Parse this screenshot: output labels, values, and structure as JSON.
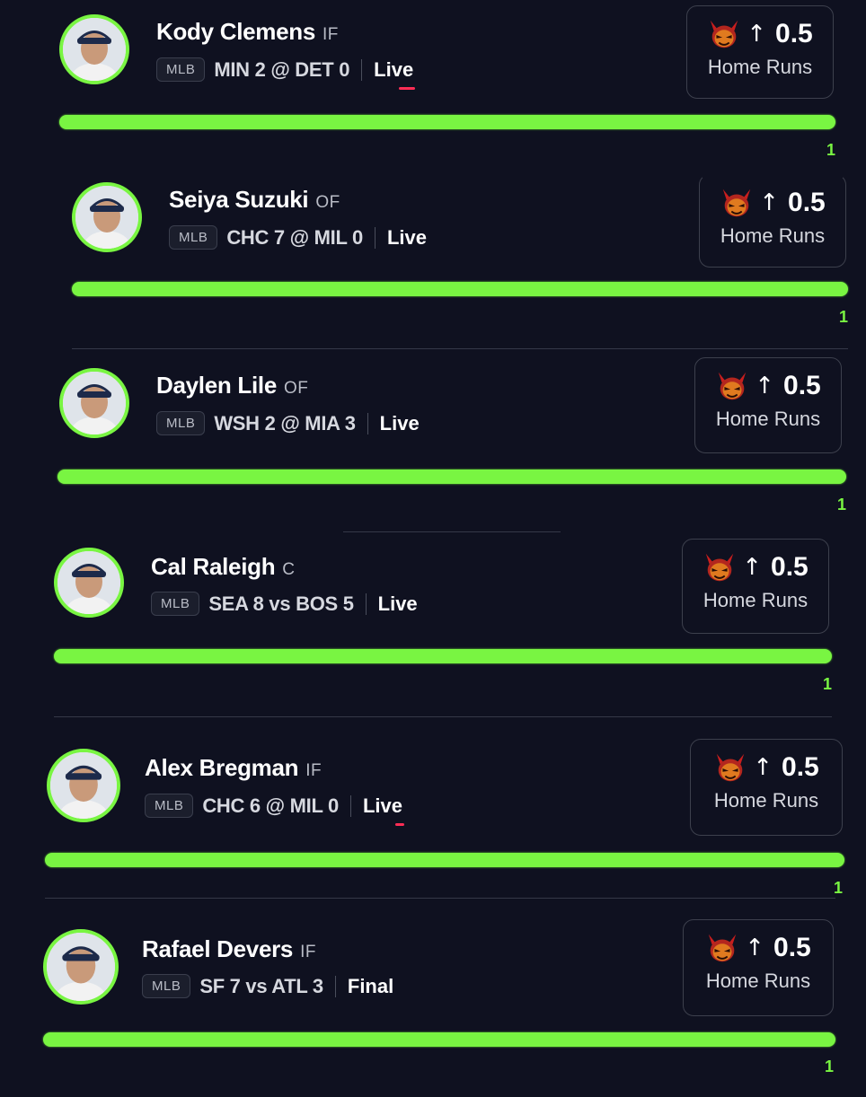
{
  "accent_color": "#79f542",
  "live_color": "#ff2d55",
  "picks": [
    {
      "player": "Kody Clemens",
      "position": "IF",
      "league": "MLB",
      "score": "MIN 2 @ DET 0",
      "status": "Live",
      "direction_icon": "arrow-up-icon",
      "line": "0.5",
      "stat": "Home Runs",
      "progress": "1",
      "progress_fraction": 1.0
    },
    {
      "player": "Seiya Suzuki",
      "position": "OF",
      "league": "MLB",
      "score": "CHC 7 @ MIL 0",
      "status": "Live",
      "direction_icon": "arrow-up-icon",
      "line": "0.5",
      "stat": "Home Runs",
      "progress": "1",
      "progress_fraction": 1.0
    },
    {
      "player": "Daylen Lile",
      "position": "OF",
      "league": "MLB",
      "score": "WSH 2 @ MIA 3",
      "status": "Live",
      "direction_icon": "arrow-up-icon",
      "line": "0.5",
      "stat": "Home Runs",
      "progress": "1",
      "progress_fraction": 1.0
    },
    {
      "player": "Cal Raleigh",
      "position": "C",
      "league": "MLB",
      "score": "SEA 8 vs BOS 5",
      "status": "Live",
      "direction_icon": "arrow-up-icon",
      "line": "0.5",
      "stat": "Home Runs",
      "progress": "1",
      "progress_fraction": 1.0
    },
    {
      "player": "Alex Bregman",
      "position": "IF",
      "league": "MLB",
      "score": "CHC 6 @ MIL 0",
      "status": "Live",
      "direction_icon": "arrow-up-icon",
      "line": "0.5",
      "stat": "Home Runs",
      "progress": "1",
      "progress_fraction": 1.0
    },
    {
      "player": "Rafael Devers",
      "position": "IF",
      "league": "MLB",
      "score": "SF 7 vs ATL 3",
      "status": "Final",
      "direction_icon": "arrow-up-icon",
      "line": "0.5",
      "stat": "Home Runs",
      "progress": "1",
      "progress_fraction": 1.0
    }
  ]
}
